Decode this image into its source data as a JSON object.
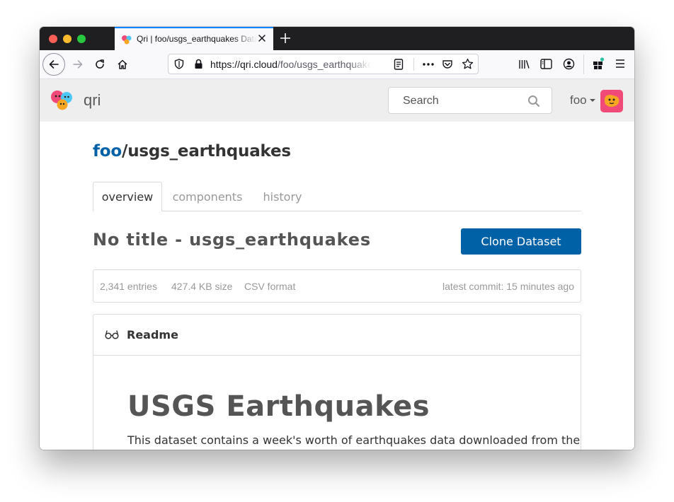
{
  "browser": {
    "tab_title": "Qri | foo/usgs_earthquakes Data",
    "url_host": "https://qri.cloud",
    "url_path": "/foo/usgs_earthquakes"
  },
  "header": {
    "app_name": "qri",
    "search_placeholder": "Search",
    "username": "foo"
  },
  "dataset": {
    "owner": "foo",
    "separator": "/",
    "name": "usgs_earthquakes",
    "tabs": [
      {
        "label": "overview",
        "active": true
      },
      {
        "label": "components",
        "active": false
      },
      {
        "label": "history",
        "active": false
      }
    ],
    "title": "No title - usgs_earthquakes",
    "clone_label": "Clone Dataset",
    "meta": {
      "entries": "2,341 entries",
      "size": "427.4 KB size",
      "format": "CSV format",
      "commit": "latest commit: 15 minutes ago"
    }
  },
  "readme": {
    "label": "Readme",
    "heading": "USGS Earthquakes",
    "text": "This dataset contains a week's worth of earthquakes data downloaded from the"
  },
  "colors": {
    "accent": "#0061a6",
    "tab_highlight": "#0a84ff",
    "avatar_bg": "#ef4a78"
  }
}
